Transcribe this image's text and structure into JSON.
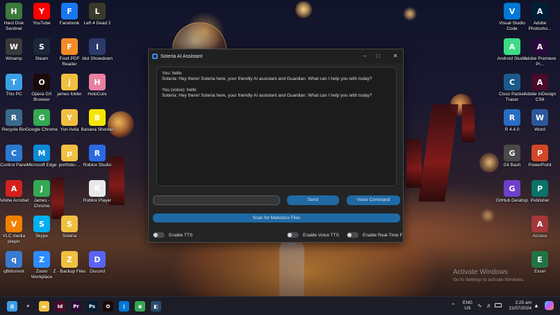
{
  "desktop": {
    "icons_left": [
      {
        "label": "Hard Disk Sentinel",
        "icon": "hard-disk-icon",
        "color": "#3c7a3c"
      },
      {
        "label": "YouTube",
        "icon": "youtube-icon",
        "color": "#ff0000"
      },
      {
        "label": "Facebook",
        "icon": "facebook-icon",
        "color": "#1877f2"
      },
      {
        "label": "Left 4 Dead 2",
        "icon": "left4dead-icon",
        "color": "#3a3a2a"
      },
      {
        "label": "Winamp",
        "icon": "winamp-icon",
        "color": "#3a3a3a"
      },
      {
        "label": "Steam",
        "icon": "steam-icon",
        "color": "#1b2838"
      },
      {
        "label": "Foxit PDF Reader",
        "icon": "foxit-icon",
        "color": "#f28c28"
      },
      {
        "label": "Idol Showdown",
        "icon": "idol-showdown-icon",
        "color": "#2a3a6a"
      },
      {
        "label": "This PC",
        "icon": "pc-icon",
        "color": "#3aa0e6"
      },
      {
        "label": "Opera GX Browser",
        "icon": "opera-gx-icon",
        "color": "#1a0a0a"
      },
      {
        "label": "james folder",
        "icon": "folder-icon",
        "color": "#f0c040"
      },
      {
        "label": "HoloCure",
        "icon": "holocure-icon",
        "color": "#e880a0"
      },
      {
        "label": "Recycle Bin",
        "icon": "recycle-bin-icon",
        "color": "#3a6a8a"
      },
      {
        "label": "Google Chrome",
        "icon": "chrome-icon",
        "color": "#34a853"
      },
      {
        "label": "Yuri Avila",
        "icon": "folder-icon",
        "color": "#f0c040"
      },
      {
        "label": "Banana Shooter",
        "icon": "banana-shooter-icon",
        "color": "#f5e600"
      },
      {
        "label": "Control Panel",
        "icon": "control-panel-icon",
        "color": "#2a7ad0"
      },
      {
        "label": "Microsoft Edge",
        "icon": "edge-icon",
        "color": "#0c8ad8"
      },
      {
        "label": "portfolio-...",
        "icon": "folder-icon",
        "color": "#f0c040"
      },
      {
        "label": "Roblox Studio",
        "icon": "roblox-studio-icon",
        "color": "#2a6ae0"
      },
      {
        "label": "Adobe Acrobat",
        "icon": "acrobat-icon",
        "color": "#d4201c"
      },
      {
        "label": "James - Chrome",
        "icon": "chrome-profile-icon",
        "color": "#34a853"
      },
      {
        "label": "",
        "icon": "",
        "color": ""
      },
      {
        "label": "Roblox Player",
        "icon": "roblox-icon",
        "color": "#e8e8e8"
      },
      {
        "label": "VLC media player",
        "icon": "vlc-icon",
        "color": "#f08000"
      },
      {
        "label": "Skype",
        "icon": "skype-icon",
        "color": "#00aff0"
      },
      {
        "label": "Soteria",
        "icon": "folder-icon",
        "color": "#f0c040"
      },
      {
        "label": "",
        "icon": "",
        "color": ""
      },
      {
        "label": "qBittorrent",
        "icon": "qbittorrent-icon",
        "color": "#3a7ad0"
      },
      {
        "label": "Zoom Workplace",
        "icon": "zoom-icon",
        "color": "#2d8cff"
      },
      {
        "label": "Z - Backup Files",
        "icon": "folder-icon",
        "color": "#f0c040"
      },
      {
        "label": "Discord",
        "icon": "discord-icon",
        "color": "#5865f2"
      }
    ],
    "icons_right": [
      {
        "label": "Visual Studio Code",
        "icon": "vscode-icon",
        "color": "#0078d4"
      },
      {
        "label": "Adobe Photosho...",
        "icon": "photoshop-icon",
        "color": "#001e36"
      },
      {
        "label": "Android Studio",
        "icon": "android-studio-icon",
        "color": "#3ddc84"
      },
      {
        "label": "Adobe Premiere Pr...",
        "icon": "premiere-icon",
        "color": "#2a0a3a"
      },
      {
        "label": "Cisco Packet Tracer",
        "icon": "cisco-icon",
        "color": "#1a5a8a"
      },
      {
        "label": "Adobe InDesign CS6",
        "icon": "indesign-icon",
        "color": "#4a0a2a"
      },
      {
        "label": "R 4.4.0",
        "icon": "r-icon",
        "color": "#276dc3"
      },
      {
        "label": "Word",
        "icon": "word-icon",
        "color": "#2b579a"
      },
      {
        "label": "Git Bash",
        "icon": "git-bash-icon",
        "color": "#4a4a4a"
      },
      {
        "label": "PowerPoint",
        "icon": "powerpoint-icon",
        "color": "#d24726"
      },
      {
        "label": "GitHub Desktop",
        "icon": "github-desktop-icon",
        "color": "#6e40c9"
      },
      {
        "label": "Publisher",
        "icon": "publisher-icon",
        "color": "#077568"
      },
      {
        "label": "",
        "icon": "",
        "color": ""
      },
      {
        "label": "Access",
        "icon": "access-icon",
        "color": "#a4373a"
      },
      {
        "label": "",
        "icon": "",
        "color": ""
      },
      {
        "label": "Excel",
        "icon": "excel-icon",
        "color": "#217346"
      }
    ]
  },
  "app": {
    "title": "Soteria AI Assistant",
    "chat_lines": [
      "You: hello",
      "Soteria: Hey there! Soteria here, your friendly AI assistant and Guardian. What can I help you with today?",
      "",
      "You (voice): hello",
      "Soteria: Hey there! Soteria here, your friendly AI assistant and Guardian. What can I help you with today?"
    ],
    "message_value": "",
    "send_label": "Send",
    "voice_label": "Voice Command",
    "scan_label": "Scan for Malicious Files",
    "toggles": [
      {
        "label": "Enable TTS",
        "on": false
      },
      {
        "label": "Enable Voice TTS",
        "on": false
      },
      {
        "label": "Enable Real-Time F",
        "on": false
      }
    ],
    "colors": {
      "accent": "#1f6aa5",
      "window_bg": "#242424",
      "chat_bg": "#1c1c1c"
    }
  },
  "watermark": {
    "line1": "Activate Windows",
    "line2": "Go to Settings to activate Windows."
  },
  "taskbar": {
    "apps": [
      {
        "name": "windows-start-icon",
        "glyph": "⊞",
        "color": "#3a9ee6"
      },
      {
        "name": "search-icon",
        "glyph": "⌕",
        "color": "#1d1d28"
      },
      {
        "name": "file-explorer-icon",
        "glyph": "▬",
        "color": "#f0c040"
      },
      {
        "name": "indesign-icon",
        "glyph": "Id",
        "color": "#4a0a2a"
      },
      {
        "name": "premiere-icon",
        "glyph": "Pr",
        "color": "#2a0a3a"
      },
      {
        "name": "photoshop-icon",
        "glyph": "Ps",
        "color": "#001e36"
      },
      {
        "name": "opera-gx-icon",
        "glyph": "O",
        "color": "#1a0a0a"
      },
      {
        "name": "vscode-icon",
        "glyph": "⟩",
        "color": "#0078d4"
      },
      {
        "name": "chrome-profile-icon",
        "glyph": "◉",
        "color": "#34a853"
      },
      {
        "name": "soteria-app-icon",
        "glyph": "◧",
        "color": "#2a4a6a"
      }
    ],
    "lang_top": "ENG",
    "lang_bottom": "US",
    "time": "2:25 am",
    "date": "21/07/2024"
  }
}
